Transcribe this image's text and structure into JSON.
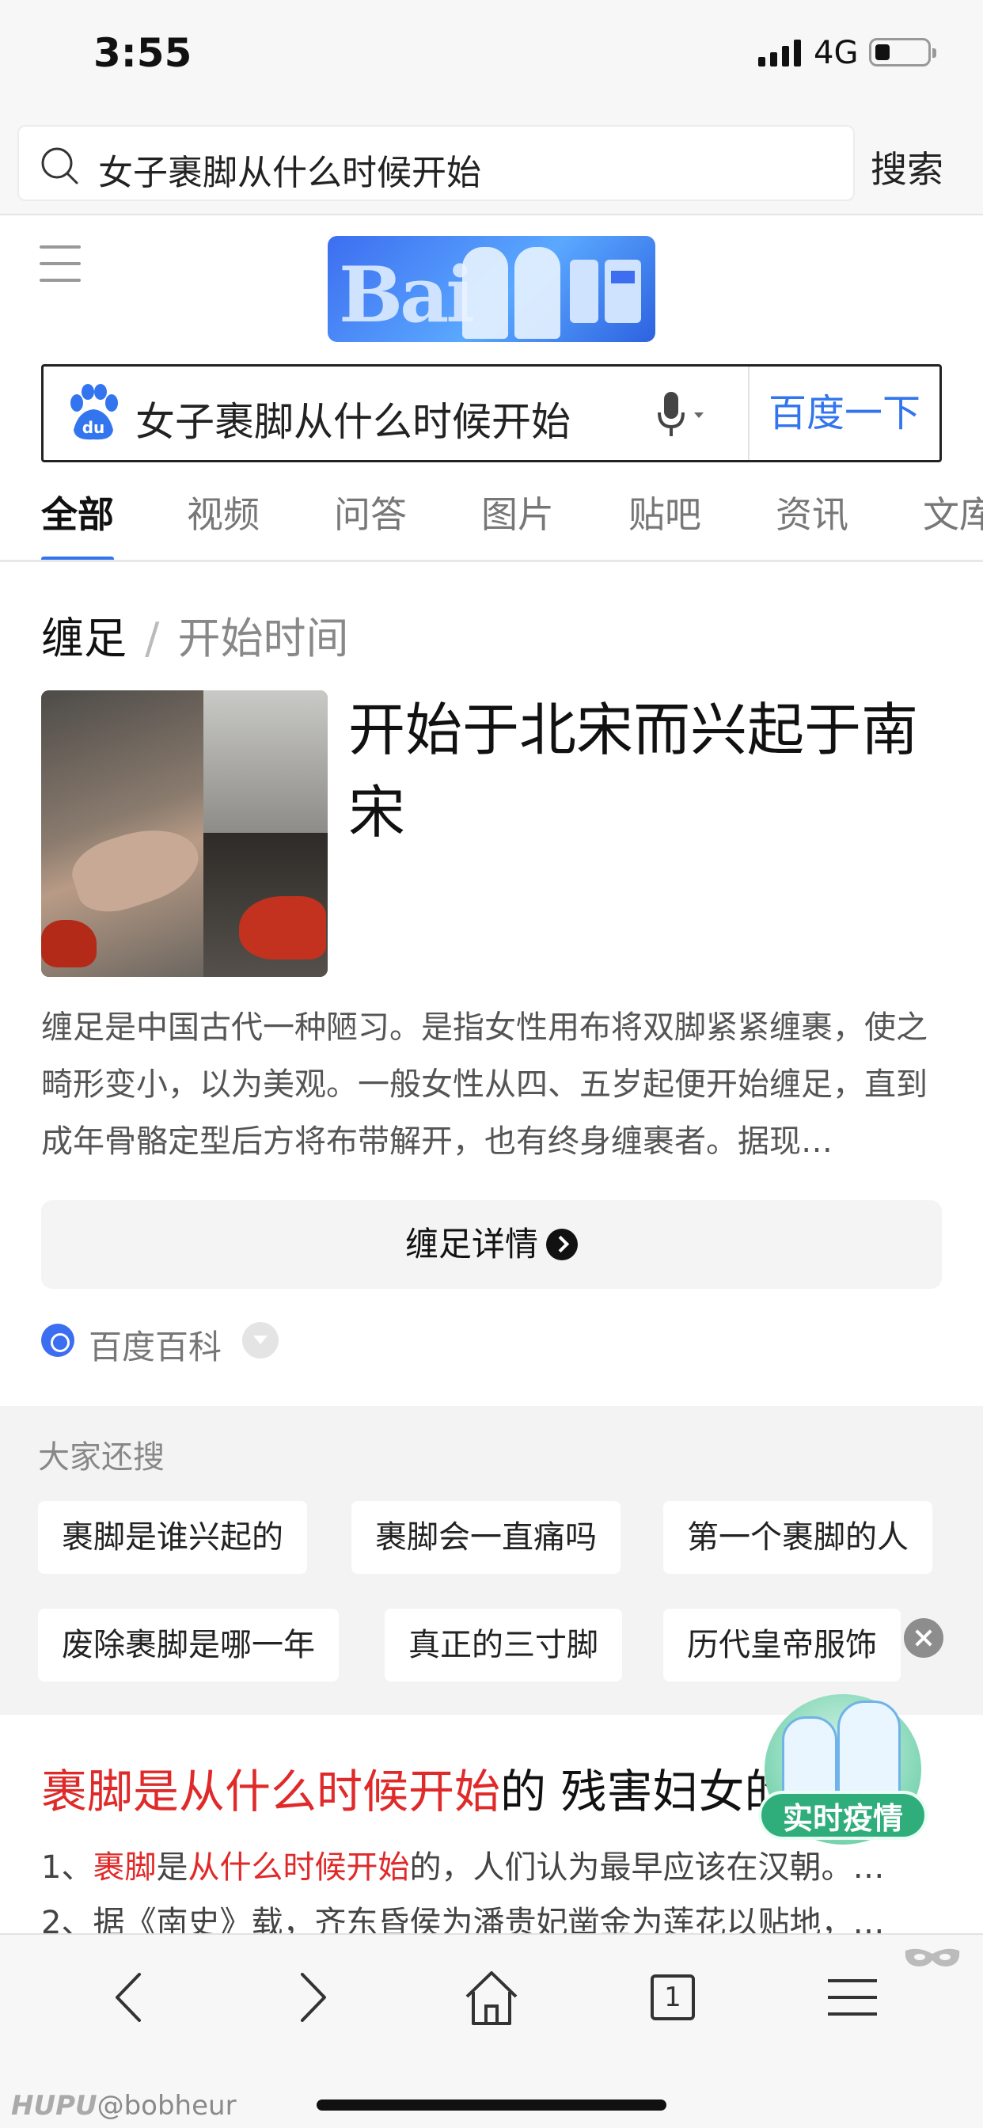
{
  "status_bar": {
    "time": "3:55",
    "network": "4G"
  },
  "browser_bar": {
    "query": "女子裹脚从什么时候开始",
    "search_label": "搜索"
  },
  "baidu": {
    "query": "女子裹脚从什么时候开始",
    "search_button": "百度一下",
    "accent_color": "#3275ee"
  },
  "tabs": [
    "全部",
    "视频",
    "问答",
    "图片",
    "贴吧",
    "资讯",
    "文库"
  ],
  "card": {
    "keyword": "缠足",
    "separator": "/",
    "subtitle": "开始时间",
    "answer": "开始于北宋而兴起于南宋",
    "description": "缠足是中国古代一种陋习。是指女性用布将双脚紧紧缠裹，使之畸形变小，以为美观。一般女性从四、五岁起便开始缠足，直到成年骨骼定型后方将布带解开，也有终身缠裹者。据现…",
    "detail_button": "缠足详情",
    "source": "百度百科"
  },
  "related": {
    "title": "大家还搜",
    "row1": [
      "裹脚是谁兴起的",
      "裹脚会一直痛吗",
      "第一个裹脚的人"
    ],
    "row2": [
      "废除裹脚是哪一年",
      "真正的三寸脚",
      "历代皇帝服饰"
    ]
  },
  "result2": {
    "title_highlight": "裹脚是从什么时候开始",
    "title_rest": "的 残害妇女的",
    "line1_prefix": "1、",
    "line1_hl1": "裹脚",
    "line1_mid": "是",
    "line1_hl2": "从什么时候开始",
    "line1_rest": "的，人们认为最早应该在汉朝。…",
    "line2": "2、据《南史》载，齐东昏侯为潘贵妃凿金为莲花以贴地，…"
  },
  "badge": {
    "label": "实时疫情"
  },
  "toolbar": {
    "tab_count": "1"
  },
  "watermark": {
    "brand": "HUPU",
    "user": "@bobheur"
  }
}
